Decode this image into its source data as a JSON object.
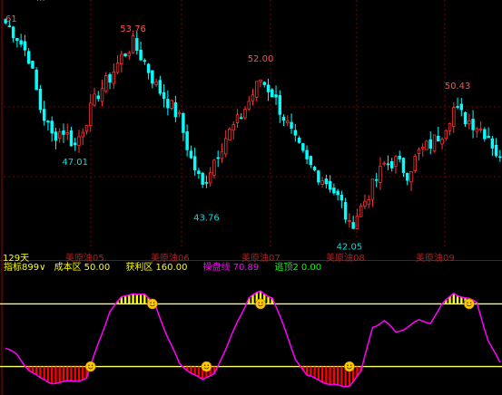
{
  "top_clipped_text": "...",
  "y_edge_label": "61",
  "period_label": "129天",
  "month_labels": [
    "美原油05",
    "美原油06",
    "美原油07",
    "美原油08",
    "美原油09"
  ],
  "indicator": {
    "name": "指标899",
    "dropdown_glyph": "∨",
    "cost_label": "成本区",
    "cost_value": "50.00",
    "profit_label": "获利区",
    "profit_value": "160.00",
    "trade_label": "操盘线",
    "trade_value": "70.89",
    "sell_label": "逃顶2",
    "sell_value": "0.00"
  },
  "colors": {
    "up": "#ff3232",
    "down": "#00ffff",
    "peak_label": "#ff5050",
    "trough_label": "#00e0e0",
    "grid": "#7a0000",
    "axis": "#a00000",
    "trade_line": "#ff00ff",
    "band_line": "#ffff66",
    "top_hist": "#ffff00",
    "bottom_hist": "#ff0000",
    "cost_color": "#ffff00",
    "profit_color": "#ffff00",
    "trade_color": "#ff00ff",
    "sell_color": "#00ff00",
    "name_color": "#ffff00",
    "month_color": "#aa2222",
    "period_color": "#ffff00",
    "smile_face": "#ffcc00"
  },
  "icons": [
    "smile-face-icon",
    "dropdown-chevron-icon"
  ],
  "price_annotations": [
    {
      "text": "53.76",
      "type": "peak",
      "i": 33,
      "price": 53.76
    },
    {
      "text": "52.00",
      "type": "peak",
      "i": 66,
      "price": 52.0
    },
    {
      "text": "50.43",
      "type": "peak",
      "i": 117,
      "price": 50.43
    },
    {
      "text": "47.01",
      "type": "trough",
      "i": 18,
      "price": 47.01
    },
    {
      "text": "43.76",
      "type": "trough",
      "i": 52,
      "price": 43.76
    },
    {
      "text": "42.05",
      "type": "trough",
      "i": 89,
      "price": 42.05
    }
  ],
  "chart_data": {
    "type": "candlestick",
    "price_range": [
      41.5,
      55.3
    ],
    "oscillator_range": [
      0,
      210
    ],
    "oscillator_levels": [
      50,
      160
    ],
    "candles_count": 129,
    "anchors": [
      [
        0,
        54.6
      ],
      [
        3,
        53.8
      ],
      [
        6,
        52.6
      ],
      [
        9,
        49.6
      ],
      [
        12,
        48.0
      ],
      [
        15,
        48.3
      ],
      [
        18,
        47.4
      ],
      [
        21,
        49.0
      ],
      [
        24,
        50.5
      ],
      [
        27,
        51.4
      ],
      [
        30,
        52.6
      ],
      [
        33,
        53.4
      ],
      [
        36,
        52.3
      ],
      [
        39,
        50.9
      ],
      [
        42,
        50.0
      ],
      [
        45,
        49.0
      ],
      [
        48,
        46.6
      ],
      [
        51,
        45.0
      ],
      [
        54,
        46.6
      ],
      [
        57,
        47.9
      ],
      [
        60,
        48.8
      ],
      [
        63,
        50.0
      ],
      [
        66,
        51.3
      ],
      [
        69,
        50.5
      ],
      [
        72,
        49.1
      ],
      [
        75,
        47.6
      ],
      [
        78,
        46.4
      ],
      [
        81,
        45.7
      ],
      [
        84,
        45.1
      ],
      [
        87,
        44.0
      ],
      [
        89,
        42.6
      ],
      [
        92,
        43.8
      ],
      [
        95,
        45.0
      ],
      [
        98,
        46.3
      ],
      [
        101,
        46.5
      ],
      [
        104,
        45.8
      ],
      [
        107,
        47.0
      ],
      [
        110,
        47.5
      ],
      [
        113,
        48.2
      ],
      [
        116,
        49.6
      ],
      [
        119,
        49.0
      ],
      [
        122,
        48.6
      ],
      [
        125,
        48.0
      ],
      [
        128,
        46.5
      ]
    ],
    "trade_line_points": [
      [
        0,
        82
      ],
      [
        3,
        70
      ],
      [
        6,
        45
      ],
      [
        9,
        28
      ],
      [
        12,
        22
      ],
      [
        15,
        22
      ],
      [
        18,
        25
      ],
      [
        21,
        30
      ],
      [
        24,
        90
      ],
      [
        27,
        148
      ],
      [
        30,
        170
      ],
      [
        33,
        180
      ],
      [
        36,
        175
      ],
      [
        39,
        155
      ],
      [
        42,
        100
      ],
      [
        45,
        55
      ],
      [
        48,
        40
      ],
      [
        51,
        25
      ],
      [
        54,
        40
      ],
      [
        57,
        78
      ],
      [
        60,
        130
      ],
      [
        63,
        170
      ],
      [
        66,
        182
      ],
      [
        69,
        172
      ],
      [
        72,
        120
      ],
      [
        75,
        65
      ],
      [
        78,
        33
      ],
      [
        81,
        28
      ],
      [
        84,
        18
      ],
      [
        87,
        15
      ],
      [
        89,
        18
      ],
      [
        92,
        40
      ],
      [
        95,
        120
      ],
      [
        98,
        130
      ],
      [
        101,
        110
      ],
      [
        104,
        120
      ],
      [
        107,
        130
      ],
      [
        110,
        128
      ],
      [
        113,
        158
      ],
      [
        116,
        180
      ],
      [
        119,
        170
      ],
      [
        122,
        162
      ],
      [
        125,
        95
      ],
      [
        128,
        55
      ]
    ],
    "top_hist": [
      [
        27,
        34,
        1.0
      ],
      [
        62,
        69,
        1.0
      ],
      [
        112,
        121,
        1.0
      ]
    ],
    "bottom_hist": [
      [
        8,
        22,
        1.0
      ],
      [
        43,
        52,
        1.0
      ],
      [
        75,
        91,
        1.0
      ]
    ],
    "smile_at": [
      [
        38,
        160
      ],
      [
        22,
        50
      ],
      [
        52,
        50
      ],
      [
        89,
        50
      ],
      [
        66,
        160
      ],
      [
        120,
        160
      ]
    ]
  }
}
